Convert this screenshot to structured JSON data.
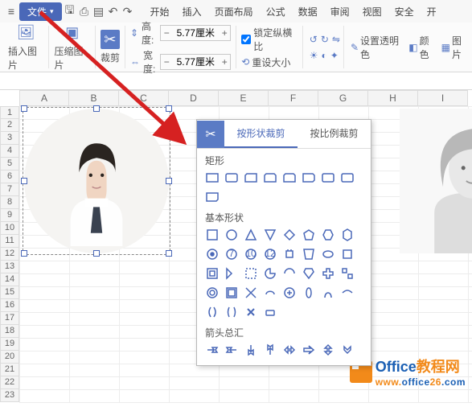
{
  "menu": {
    "file": "文件",
    "tabs": [
      "开始",
      "插入",
      "页面布局",
      "公式",
      "数据",
      "审阅",
      "视图",
      "安全",
      "开"
    ]
  },
  "ribbon": {
    "insert_pic": "插入图片",
    "compress_pic": "压缩图片",
    "crop": "裁剪",
    "height_label": "高度:",
    "width_label": "宽度:",
    "height_val": "5.77厘米",
    "width_val": "5.77厘米",
    "lock_ratio": "锁定纵横比",
    "reset_size": "重设大小",
    "set_transparent": "设置透明色",
    "color": "颜色",
    "pic_more": "图片"
  },
  "sheet": {
    "columns": [
      "A",
      "B",
      "C",
      "D",
      "E",
      "F",
      "G",
      "H",
      "I"
    ],
    "rows": [
      "1",
      "2",
      "3",
      "4",
      "5",
      "6",
      "7",
      "8",
      "9",
      "10",
      "11",
      "12",
      "13",
      "14",
      "15",
      "16",
      "17",
      "18",
      "19",
      "20",
      "21",
      "22",
      "23"
    ]
  },
  "drop": {
    "tab_shape": "按形状裁剪",
    "tab_ratio": "按比例裁剪",
    "sec_rect": "矩形",
    "sec_basic": "基本形状",
    "sec_arrows": "箭头总汇"
  },
  "watermark": {
    "brand1": "Office",
    "brand2": "教程网",
    "url": "www.office26.com"
  }
}
